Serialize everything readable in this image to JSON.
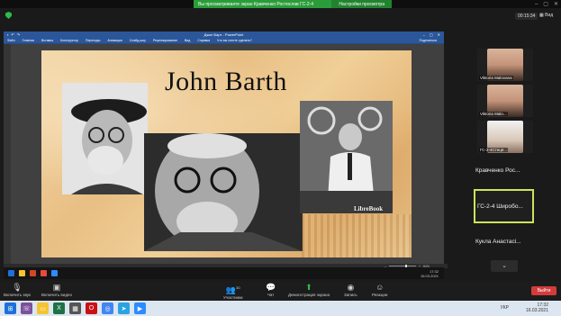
{
  "zoom": {
    "share_banner": "Вы просматриваете экран Кравченко Ростислав ГС-2-4",
    "view_options": "Настройки просмотра",
    "timer": "00:15:34",
    "view_label": "Вид",
    "toolbar": {
      "mute": "Включить звук",
      "video": "Включить видео",
      "participants": "Участники",
      "participants_count": "30",
      "chat": "Чат",
      "share": "Демонстрация экрана",
      "record": "Запись",
      "reactions": "Реакции",
      "end": "Выйти"
    },
    "participants": [
      {
        "name": "Viktoria Malovana"
      },
      {
        "name": "Viktoria Malo..."
      },
      {
        "name": "ГС-2-4Стеця..."
      }
    ],
    "text_tiles": [
      "Кравченко Рос...",
      "ГС-2-4 Широбо...",
      "Кукла Анастасі..."
    ]
  },
  "ppt": {
    "title": "Джон Барт - PowerPoint",
    "ribbon": [
      "Файл",
      "Главная",
      "Вставка",
      "Конструктор",
      "Переходы",
      "Анимация",
      "Слайд-шоу",
      "Рецензирование",
      "Вид",
      "Справка",
      "Что вы хотите сделать?"
    ],
    "share_label": "Поделиться",
    "zoom_level": "84%"
  },
  "slide": {
    "title": "John Barth",
    "watermark": "LibreBook"
  },
  "inner_clock": {
    "time": "17:32",
    "date": "16.03.2021"
  },
  "os": {
    "lang": "УКР",
    "time": "17:32",
    "date": "16.03.2021",
    "apps": [
      "viber-icon",
      "explorer-icon",
      "excel-icon",
      "app-icon",
      "opera-icon",
      "chrome-icon",
      "telegram-icon",
      "zoom-icon"
    ]
  }
}
